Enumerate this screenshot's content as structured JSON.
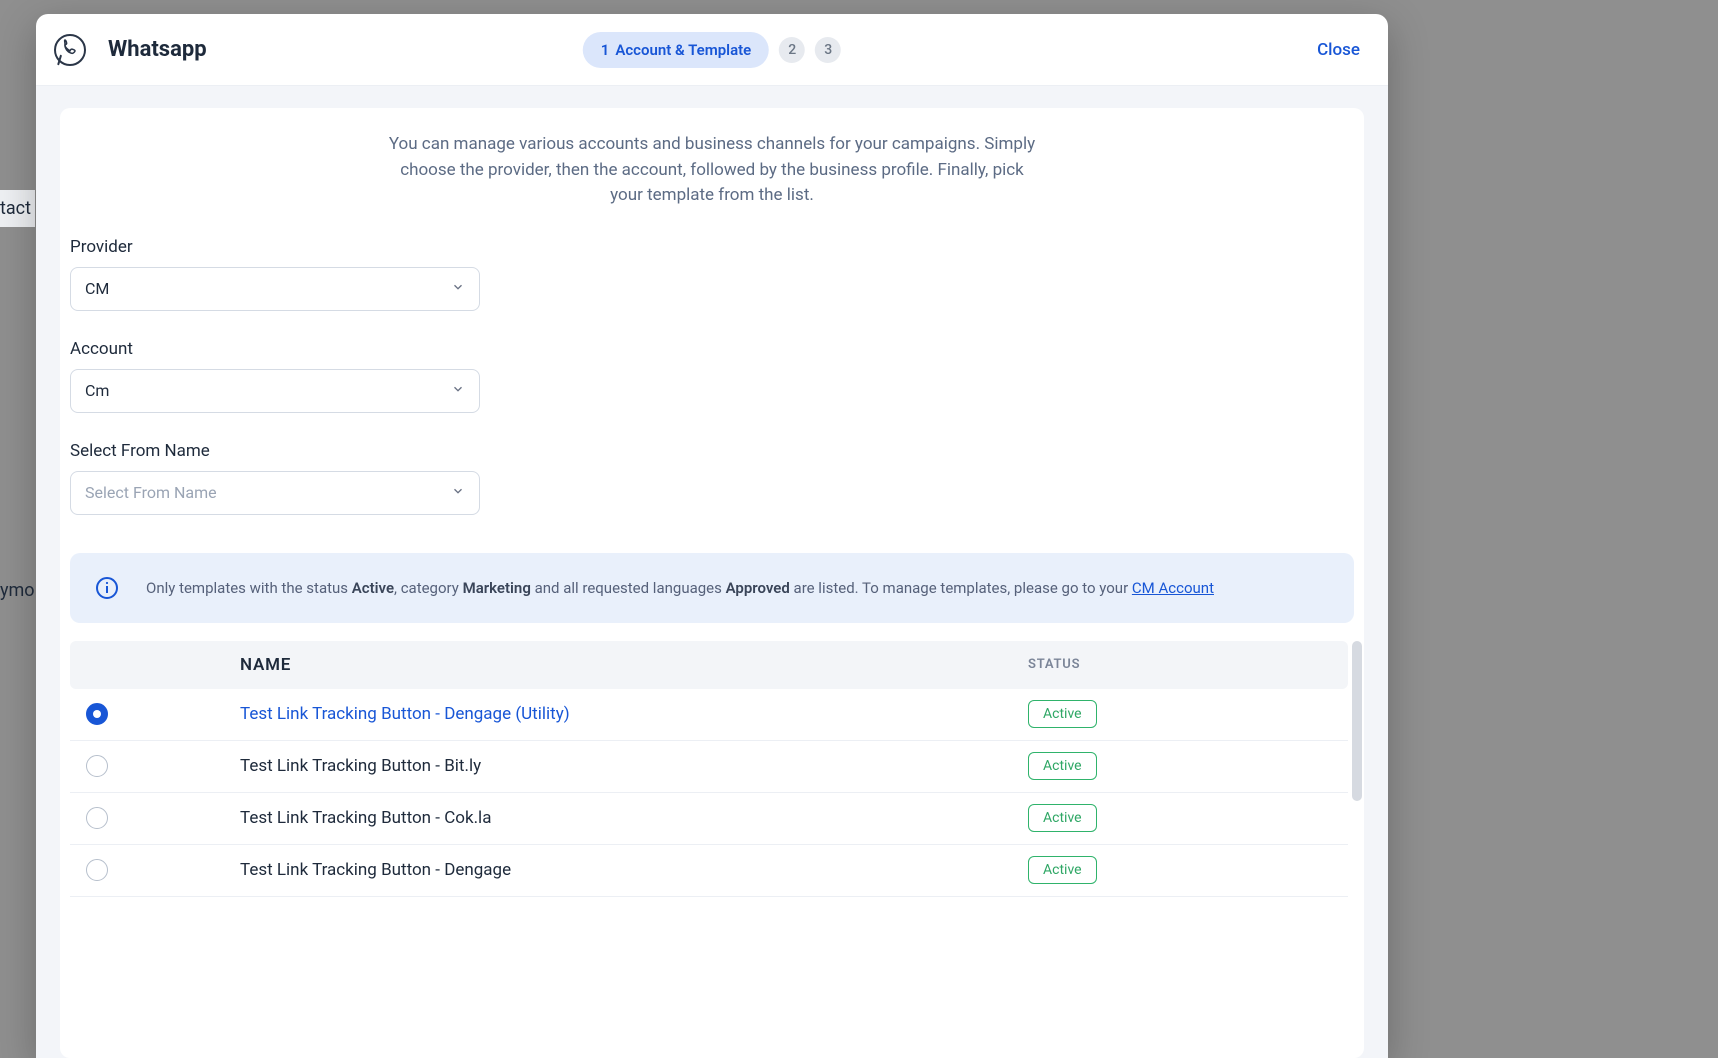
{
  "header": {
    "title": "Whatsapp",
    "close": "Close"
  },
  "steps": {
    "active_num": "1",
    "active_label": "Account & Template",
    "s2": "2",
    "s3": "3"
  },
  "intro": "You can manage various accounts and business channels for your campaigns. Simply choose the provider, then the account, followed by the business profile. Finally, pick your template from the list.",
  "fields": {
    "provider_label": "Provider",
    "provider_value": "CM",
    "account_label": "Account",
    "account_value": "Cm",
    "from_label": "Select From Name",
    "from_placeholder": "Select From Name"
  },
  "info": {
    "prefix": "Only templates with the status ",
    "status": "Active",
    "mid1": ", category ",
    "category": "Marketing",
    "mid2": " and all requested languages ",
    "approved": "Approved",
    "mid3": " are listed. To manage templates, please go to your ",
    "link": "CM Account"
  },
  "table": {
    "h_name": "NAME",
    "h_status": "STATUS",
    "rows": [
      {
        "name": "Test Link Tracking Button - Dengage (Utility)",
        "status": "Active",
        "selected": true
      },
      {
        "name": "Test Link Tracking Button - Bit.ly",
        "status": "Active",
        "selected": false
      },
      {
        "name": "Test Link Tracking Button - Cok.la",
        "status": "Active",
        "selected": false
      },
      {
        "name": "Test Link Tracking Button - Dengage",
        "status": "Active",
        "selected": false
      }
    ]
  },
  "bg": {
    "t1": "tact",
    "t2": "ymo"
  }
}
